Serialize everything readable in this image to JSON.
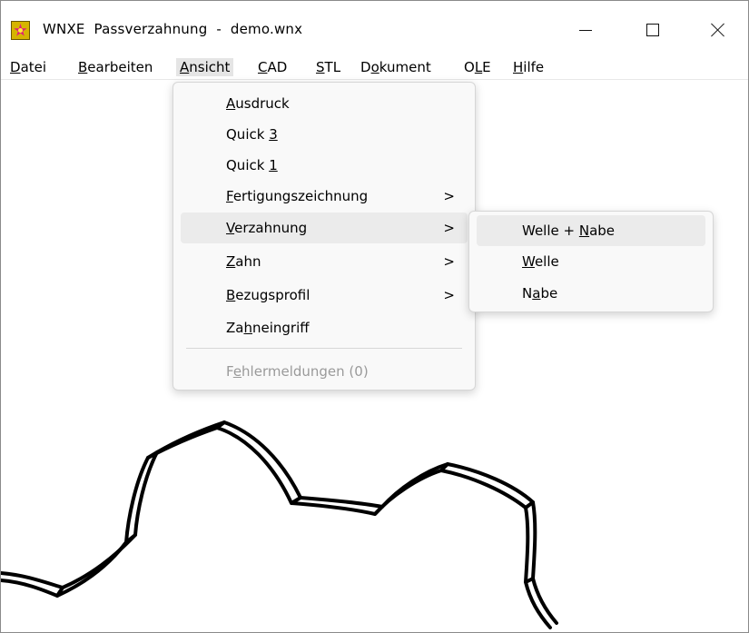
{
  "titlebar": {
    "app_name": "WNXE",
    "title": "Passverzahnung  -  demo.wnx",
    "icon": "wnxe-app-icon",
    "controls": [
      "minimize-icon",
      "maximize-icon",
      "close-icon"
    ]
  },
  "menubar": {
    "items": [
      {
        "label": "Datei",
        "underline": "D"
      },
      {
        "label": "Bearbeiten",
        "underline": "B"
      },
      {
        "label": "Ansicht",
        "underline": "A"
      },
      {
        "label": "CAD",
        "underline": "C"
      },
      {
        "label": "STL",
        "underline": "S"
      },
      {
        "label": "Dokument",
        "underline": "o"
      },
      {
        "label": "OLE",
        "underline": "L"
      },
      {
        "label": "Hilfe",
        "underline": "H"
      }
    ],
    "active": "Ansicht"
  },
  "ansicht_menu": {
    "items": [
      {
        "label": "Ausdruck",
        "submenu": false,
        "underline": "A"
      },
      {
        "label": "Quick 3",
        "submenu": false,
        "underline": "3"
      },
      {
        "label": "Quick 1",
        "submenu": false,
        "underline": "1"
      },
      {
        "label": "Fertigungszeichnung",
        "submenu": true,
        "underline": "F"
      },
      {
        "label": "Verzahnung",
        "submenu": true,
        "underline": "V"
      },
      {
        "label": "Zahn",
        "submenu": true,
        "underline": "Z"
      },
      {
        "label": "Bezugsprofil",
        "submenu": true,
        "underline": "B"
      },
      {
        "label": "Zahneingriff",
        "submenu": false,
        "underline": "h"
      },
      {
        "label": "Fehlermeldungen (0)",
        "submenu": false,
        "disabled": true,
        "underline": "e"
      }
    ],
    "hovered": "Verzahnung",
    "chevron": ">"
  },
  "verzahnung_submenu": {
    "items": [
      {
        "label": "Welle + Nabe",
        "underline": "N"
      },
      {
        "label": "Welle",
        "underline": "W"
      },
      {
        "label": "Nabe",
        "underline": "a"
      }
    ],
    "hovered": "Welle + Nabe"
  }
}
